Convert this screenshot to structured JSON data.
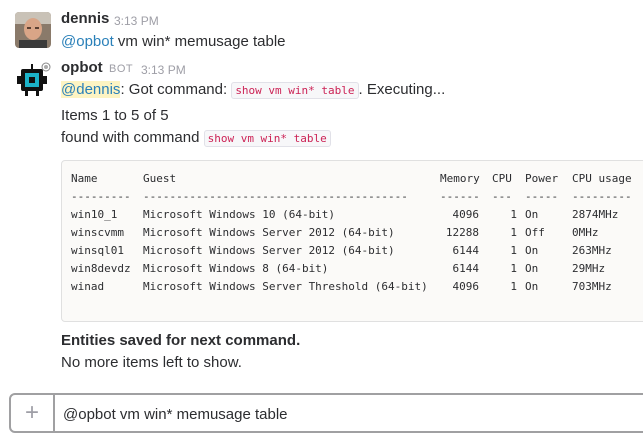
{
  "messages": [
    {
      "author": "dennis",
      "time": "3:13 PM",
      "mention": "@opbot",
      "text": " vm win* memusage table"
    },
    {
      "author": "opbot",
      "bot_tag": "BOT",
      "time": "3:13 PM",
      "mention": "@dennis",
      "text_a": ": Got command: ",
      "code_a": "show vm win* table",
      "text_b": ". Executing...",
      "items_line": "Items 1 to 5 of 5",
      "found_text": "found with command ",
      "found_code": "show vm win* table",
      "table": {
        "headers": [
          "Name",
          "Guest",
          "Memory",
          "CPU",
          "Power",
          "CPU usage"
        ],
        "separators": [
          "---------",
          "----------------------------------------",
          "------",
          "---",
          "-----",
          "---------"
        ],
        "rows": [
          [
            "win10_1",
            "Microsoft Windows 10 (64-bit)",
            "4096",
            "1",
            "On",
            "2874MHz"
          ],
          [
            "winscvmm",
            "Microsoft Windows Server 2012 (64-bit)",
            "12288",
            "1",
            "Off",
            "0MHz"
          ],
          [
            "winsql01",
            "Microsoft Windows Server 2012 (64-bit)",
            "6144",
            "1",
            "On",
            "263MHz"
          ],
          [
            "win8devdz",
            "Microsoft Windows 8 (64-bit)",
            "6144",
            "1",
            "On",
            "29MHz"
          ],
          [
            "winad",
            "Microsoft Windows Server Threshold (64-bit)",
            "4096",
            "1",
            "On",
            "703MHz"
          ]
        ]
      },
      "entities_saved": "Entities saved for next command.",
      "no_more": "No more items left to show."
    }
  ],
  "composer": {
    "value": "@opbot vm win* memusage table",
    "plus_icon": "plus-icon"
  },
  "colors": {
    "mention": "#2a80b9",
    "mention_highlight": "#fdf4c3",
    "code": "#cc2255",
    "bot_teal": "#1bb3c9"
  }
}
